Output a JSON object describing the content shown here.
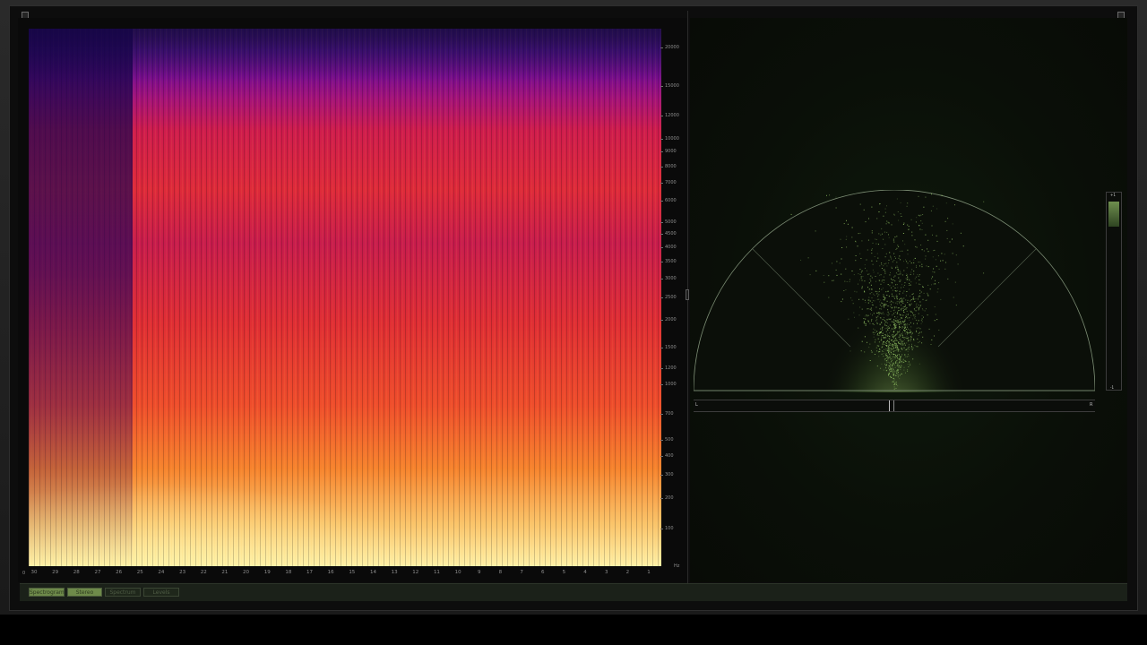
{
  "spectrogram": {
    "frequency_labels": [
      "20000",
      "15000",
      "12000",
      "10000",
      "9000",
      "8000",
      "7000",
      "6000",
      "5000",
      "4500",
      "4000",
      "3500",
      "3000",
      "2500",
      "2000",
      "1500",
      "1200",
      "1000",
      "700",
      "500",
      "400",
      "300",
      "200",
      "100"
    ],
    "frequency_unit": "Hz",
    "time_labels": [
      "30",
      "29",
      "28",
      "27",
      "26",
      "25",
      "24",
      "23",
      "22",
      "21",
      "20",
      "19",
      "18",
      "17",
      "16",
      "15",
      "14",
      "13",
      "12",
      "11",
      "10",
      "9",
      "8",
      "7",
      "6",
      "5",
      "4",
      "3",
      "2",
      "1"
    ],
    "zero_label": "0"
  },
  "stereo": {
    "left_label": "L",
    "right_label": "R",
    "balance_position": 0.5,
    "correlation_top_label": "+1",
    "correlation_bottom_label": "-1",
    "correlation_level": 0.9
  },
  "tabs": [
    {
      "label": "Spectrogram",
      "active": true
    },
    {
      "label": "Stereo",
      "active": true
    },
    {
      "label": "Spectrum",
      "active": false
    },
    {
      "label": "Levels",
      "active": false
    }
  ],
  "colors": {
    "spectrogram_low": "#241043",
    "spectrogram_mid": "#de2a3a",
    "spectrogram_high": "#fff1a8",
    "scope_dots": "#9ccf6a",
    "scope_outline": "#7b8c73"
  }
}
